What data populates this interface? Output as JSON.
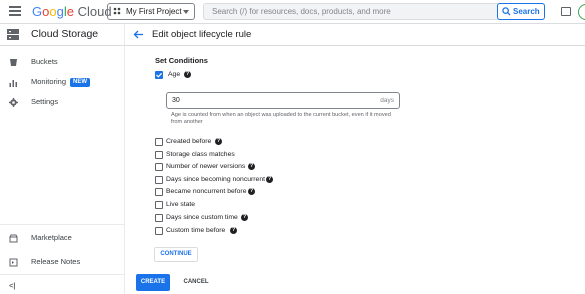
{
  "topbar": {
    "logo": {
      "g1": "G",
      "o1": "o",
      "o2": "o",
      "g2": "g",
      "l": "l",
      "e": "e",
      "cloud": "Cloud"
    },
    "project": "My First Project",
    "search_placeholder": "Search (/) for resources, docs, products, and more",
    "search_button": "Search"
  },
  "sidebar": {
    "product_title": "Cloud Storage",
    "items": [
      {
        "label": "Buckets"
      },
      {
        "label": "Monitoring",
        "badge": "NEW"
      },
      {
        "label": "Settings"
      }
    ],
    "bottom_items": [
      {
        "label": "Marketplace"
      },
      {
        "label": "Release Notes"
      }
    ],
    "collapse": "<|"
  },
  "main": {
    "page_title": "Edit object lifecycle rule",
    "section_title": "Set Conditions",
    "age": {
      "label": "Age",
      "checked": true,
      "value": "30",
      "suffix": "days",
      "hint": "Age is counted from when an object was uploaded to the current bucket, even if it moved from another"
    },
    "conditions": [
      {
        "label": "Created before",
        "help": true
      },
      {
        "label": "Storage class matches",
        "help": false
      },
      {
        "label": "Number of newer versions",
        "help": true
      },
      {
        "label": "Days since becoming noncurrent",
        "help": true
      },
      {
        "label": "Became noncurrent before",
        "help": true
      },
      {
        "label": "Live state",
        "help": false
      },
      {
        "label": "Days since custom time",
        "help": true
      },
      {
        "label": "Custom time before",
        "help": true
      }
    ],
    "help_glyph": "?",
    "continue_label": "CONTINUE",
    "create_label": "CREATE",
    "cancel_label": "CANCEL"
  },
  "colors": {
    "accent": "#1a73e8",
    "text": "#202124",
    "muted": "#5f6368",
    "border": "#dadce0"
  }
}
